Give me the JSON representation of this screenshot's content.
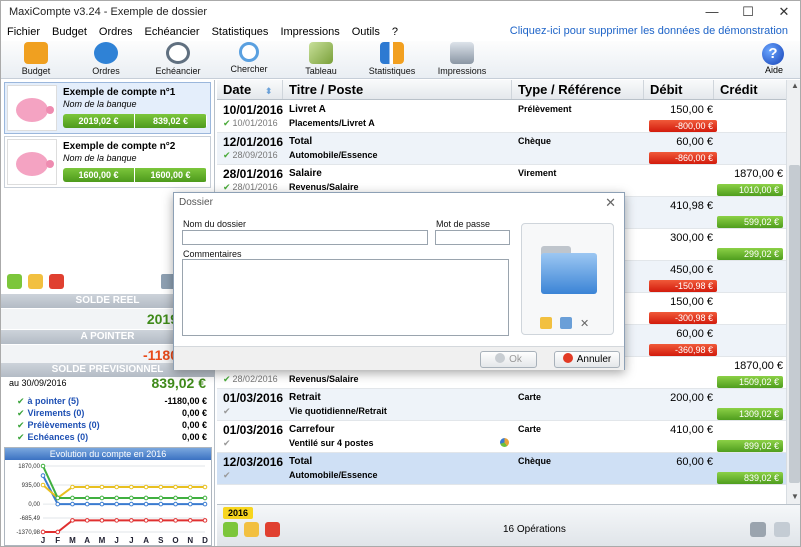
{
  "window": {
    "title": "MaxiCompte v3.24 - Exemple de dossier",
    "minimize": "—",
    "maximize": "☐",
    "close": "✕"
  },
  "menu": {
    "items": [
      "Fichier",
      "Budget",
      "Ordres",
      "Echéancier",
      "Statistiques",
      "Impressions",
      "Outils",
      "?"
    ],
    "demo_link": "Cliquez-ici pour supprimer les données de démonstration"
  },
  "toolbar": {
    "buttons": [
      {
        "label": "Budget",
        "icon": "budget-icon",
        "color": "#f0a020"
      },
      {
        "label": "Ordres",
        "icon": "gears-icon",
        "color": "#2f82d6"
      },
      {
        "label": "Echéancier",
        "icon": "stopwatch-icon",
        "color": "#607080"
      },
      {
        "label": "Chercher",
        "icon": "magnifier-icon",
        "color": "#5aa0e0"
      },
      {
        "label": "Tableau",
        "icon": "table-icon",
        "color": "#7aa03a"
      },
      {
        "label": "Statistiques",
        "icon": "bar-chart-icon",
        "color": "#2d7ad2"
      },
      {
        "label": "Impressions",
        "icon": "printer-icon",
        "color": "#8a96a4"
      }
    ],
    "help_label": "Aide",
    "help_glyph": "?"
  },
  "accounts": [
    {
      "name": "Exemple de compte n°1",
      "bank": "Nom de la banque",
      "balances": [
        "2019,02 €",
        "839,02 €"
      ]
    },
    {
      "name": "Exemple de compte n°2",
      "bank": "Nom de la banque",
      "balances": [
        "1600,00 €",
        "1600,00 €"
      ]
    }
  ],
  "summary": {
    "solde_reel_label": "SOLDE REEL",
    "solde_reel_value": "2019",
    "a_pointer_label": "A POINTER",
    "a_pointer_value": "-1180",
    "previsionnel_label": "SOLDE PREVISIONNEL",
    "previsionnel_date": "au 30/09/2016",
    "previsionnel_value": "839,02 €",
    "rows": [
      {
        "label": "à pointer (5)",
        "value": "-1180,00 €"
      },
      {
        "label": "Virements (0)",
        "value": "0,00 €"
      },
      {
        "label": "Prélèvements (0)",
        "value": "0,00 €"
      },
      {
        "label": "Echéances (0)",
        "value": "0,00 €"
      }
    ]
  },
  "chart_data": {
    "type": "line",
    "title": "Evolution du compte en 2016",
    "categories": [
      "J",
      "F",
      "M",
      "A",
      "M",
      "J",
      "J",
      "A",
      "S",
      "O",
      "N",
      "D"
    ],
    "yticks": [
      "1870,00",
      "935,00",
      "0,00",
      "-685,49",
      "-1370,98"
    ],
    "ylim": [
      -1370.98,
      1870
    ],
    "series": [
      {
        "color": "#3a7bd0",
        "values": [
          1400,
          0,
          0,
          0,
          0,
          0,
          0,
          0,
          0,
          0,
          0,
          0
        ]
      },
      {
        "color": "#e8c020",
        "values": [
          935,
          300,
          839,
          839,
          839,
          839,
          839,
          839,
          839,
          839,
          839,
          839
        ]
      },
      {
        "color": "#e03030",
        "values": [
          -1370,
          -1370,
          -800,
          -800,
          -800,
          -800,
          -800,
          -800,
          -800,
          -800,
          -800,
          -800
        ]
      },
      {
        "color": "#40b040",
        "values": [
          1870,
          300,
          300,
          300,
          300,
          300,
          300,
          300,
          300,
          300,
          300,
          300
        ]
      }
    ]
  },
  "table": {
    "headers": [
      "Date",
      "Titre / Poste",
      "Type / Référence",
      "Débit",
      "Crédit"
    ],
    "rows": [
      {
        "date": "10/01/2016",
        "vdate": "10/01/2016",
        "t1": "Livret A",
        "t2": "Placements/Livret A",
        "type": "Prélèvement",
        "debit": "150,00 €",
        "credit": "",
        "bal": "-800,00 €",
        "neg": true,
        "checked": true
      },
      {
        "date": "12/01/2016",
        "vdate": "28/09/2016",
        "t1": "Total",
        "t2": "Automobile/Essence",
        "type": "Chèque",
        "debit": "60,00 €",
        "credit": "",
        "bal": "-860,00 €",
        "neg": true,
        "checked": true
      },
      {
        "date": "28/01/2016",
        "vdate": "28/01/2016",
        "t1": "Salaire",
        "t2": "Revenus/Salaire",
        "type": "Virement",
        "debit": "",
        "credit": "1870,00 €",
        "bal": "1010,00 €",
        "neg": false,
        "checked": true
      },
      {
        "date": "",
        "vdate": "",
        "t1": "",
        "t2": "",
        "type": "",
        "debit": "410,98 €",
        "credit": "",
        "bal": "599,02 €",
        "neg": false
      },
      {
        "date": "",
        "vdate": "",
        "t1": "",
        "t2": "",
        "type": "",
        "debit": "300,00 €",
        "credit": "",
        "bal": "299,02 €",
        "neg": false
      },
      {
        "date": "",
        "vdate": "",
        "t1": "",
        "t2": "",
        "type": "",
        "debit": "450,00 €",
        "credit": "",
        "bal": "-150,98 €",
        "neg": true
      },
      {
        "date": "",
        "vdate": "",
        "t1": "",
        "t2": "",
        "type": "",
        "debit": "150,00 €",
        "credit": "",
        "bal": "-300,98 €",
        "neg": true
      },
      {
        "date": "",
        "vdate": "",
        "t1": "",
        "t2": "",
        "type": "",
        "debit": "60,00 €",
        "credit": "",
        "bal": "-360,98 €",
        "neg": true
      },
      {
        "date": "",
        "vdate": "28/02/2016",
        "t1": "",
        "t2": "Revenus/Salaire",
        "type": "",
        "debit": "",
        "credit": "1870,00 €",
        "bal": "1509,02 €",
        "neg": false,
        "checked": true
      },
      {
        "date": "01/03/2016",
        "vdate": " ",
        "t1": "Retrait",
        "t2": "Vie quotidienne/Retrait",
        "type": "Carte",
        "debit": "200,00 €",
        "credit": "",
        "bal": "1309,02 €",
        "neg": false
      },
      {
        "date": "01/03/2016",
        "vdate": " ",
        "t1": "Carrefour",
        "t2": "Ventilé sur 4 postes",
        "type": "Carte",
        "debit": "410,00 €",
        "credit": "",
        "bal": "899,02 €",
        "neg": false,
        "pie": true
      },
      {
        "date": "12/03/2016",
        "vdate": " ",
        "t1": "Total",
        "t2": "Automobile/Essence",
        "type": "Chèque",
        "debit": "60,00 €",
        "credit": "",
        "bal": "839,02 €",
        "neg": false
      }
    ]
  },
  "footer": {
    "year": "2016",
    "operations": "16 Opérations"
  },
  "dialog": {
    "title": "Dossier",
    "close": "✕",
    "name_label": "Nom du dossier",
    "name_value": "",
    "password_label": "Mot de passe",
    "password_value": "",
    "comments_label": "Commentaires",
    "ok_label": "Ok",
    "cancel_label": "Annuler"
  }
}
